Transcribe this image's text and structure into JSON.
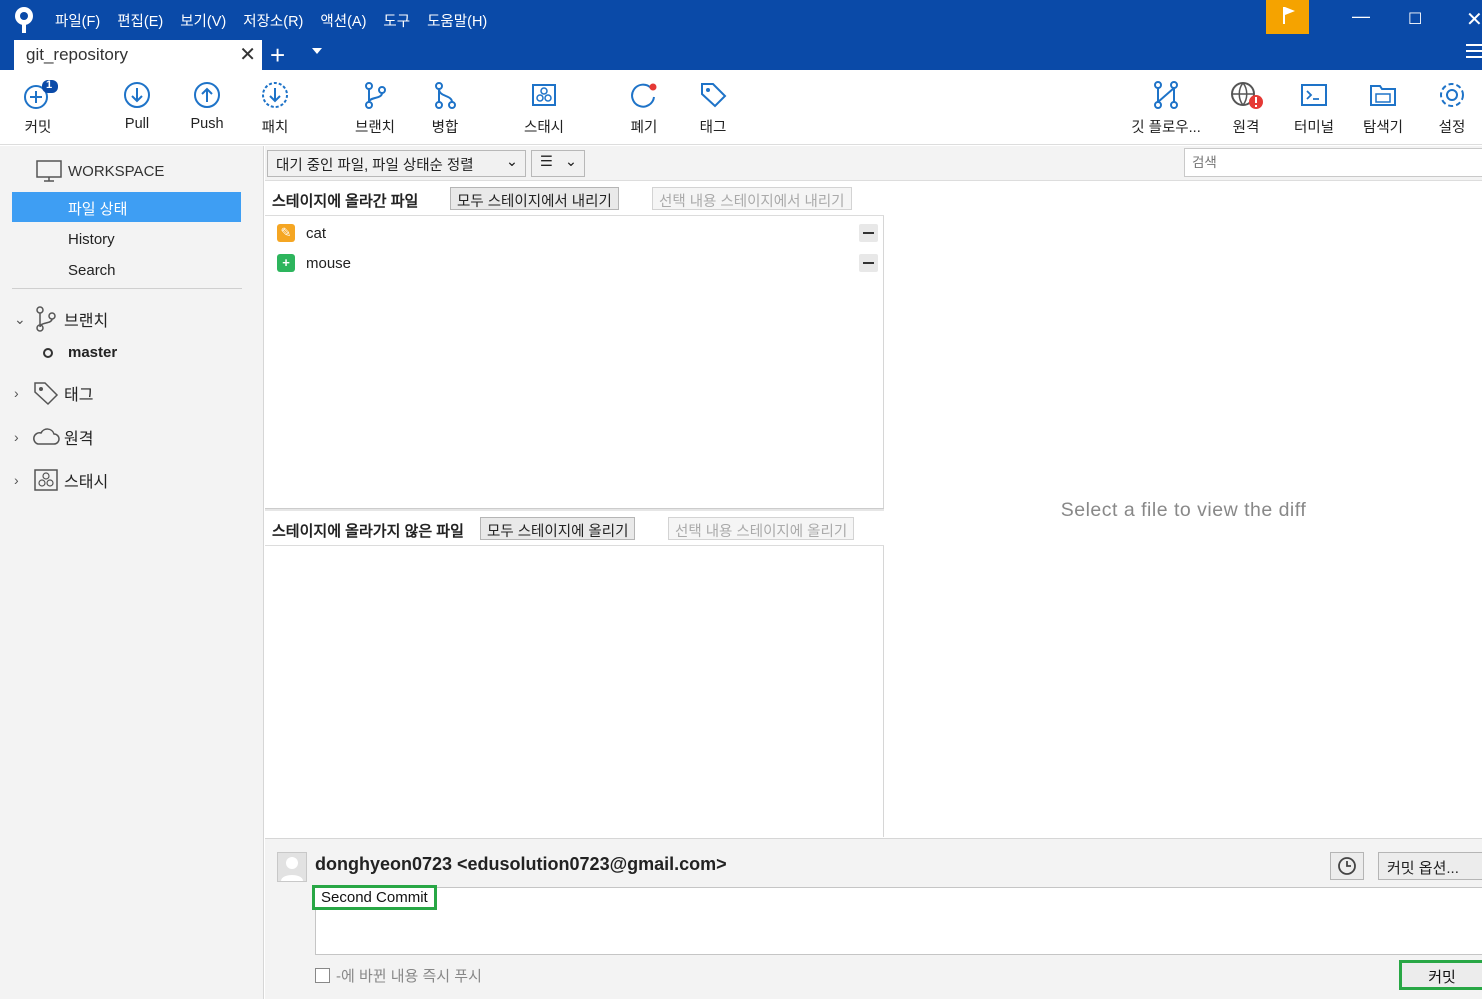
{
  "menu": [
    "파일(F)",
    "편집(E)",
    "보기(V)",
    "저장소(R)",
    "액션(A)",
    "도구",
    "도움말(H)"
  ],
  "tab": {
    "title": "git_repository"
  },
  "toolbar": {
    "commit": "커밋",
    "commit_badge": "1",
    "pull": "Pull",
    "push": "Push",
    "patch": "패치",
    "branch": "브랜치",
    "merge": "병합",
    "stash": "스태시",
    "discard": "폐기",
    "tag": "태그",
    "gitflow": "깃 플로우...",
    "remote": "원격",
    "terminal": "터미널",
    "explorer": "탐색기",
    "settings": "설정"
  },
  "sidebar": {
    "workspace": "WORKSPACE",
    "file_status": "파일 상태",
    "history": "History",
    "search": "Search",
    "branches": "브랜치",
    "current_branch": "master",
    "tags": "태그",
    "remotes": "원격",
    "stashes": "스태시"
  },
  "filter": {
    "sort": "대기 중인 파일, 파일 상태순 정렬",
    "view": "☰",
    "search_placeholder": "검색"
  },
  "staged": {
    "title": "스테이지에 올라간 파일",
    "unstage_all": "모두 스테이지에서 내리기",
    "unstage_selected": "선택 내용 스테이지에서 내리기",
    "files": [
      {
        "name": "cat",
        "status": "modified",
        "color": "#f5a623"
      },
      {
        "name": "mouse",
        "status": "added",
        "color": "#2db55d"
      }
    ]
  },
  "unstaged": {
    "title": "스테이지에 올라가지 않은 파일",
    "stage_all": "모두 스테이지에 올리기",
    "stage_selected": "선택 내용 스테이지에 올리기"
  },
  "diff": {
    "empty": "Select a file to view the diff"
  },
  "commit": {
    "author": "donghyeon0723 <edusolution0723@gmail.com>",
    "options": "커밋 옵션...",
    "message": "Second Commit",
    "push_label": "-에 바뀐 내용 즉시 푸시",
    "button": "커밋"
  },
  "colors": {
    "titlebar": "#0a4aa8",
    "accent": "#3e9ef3",
    "flag": "#f5a300",
    "highlight": "#28a745"
  }
}
